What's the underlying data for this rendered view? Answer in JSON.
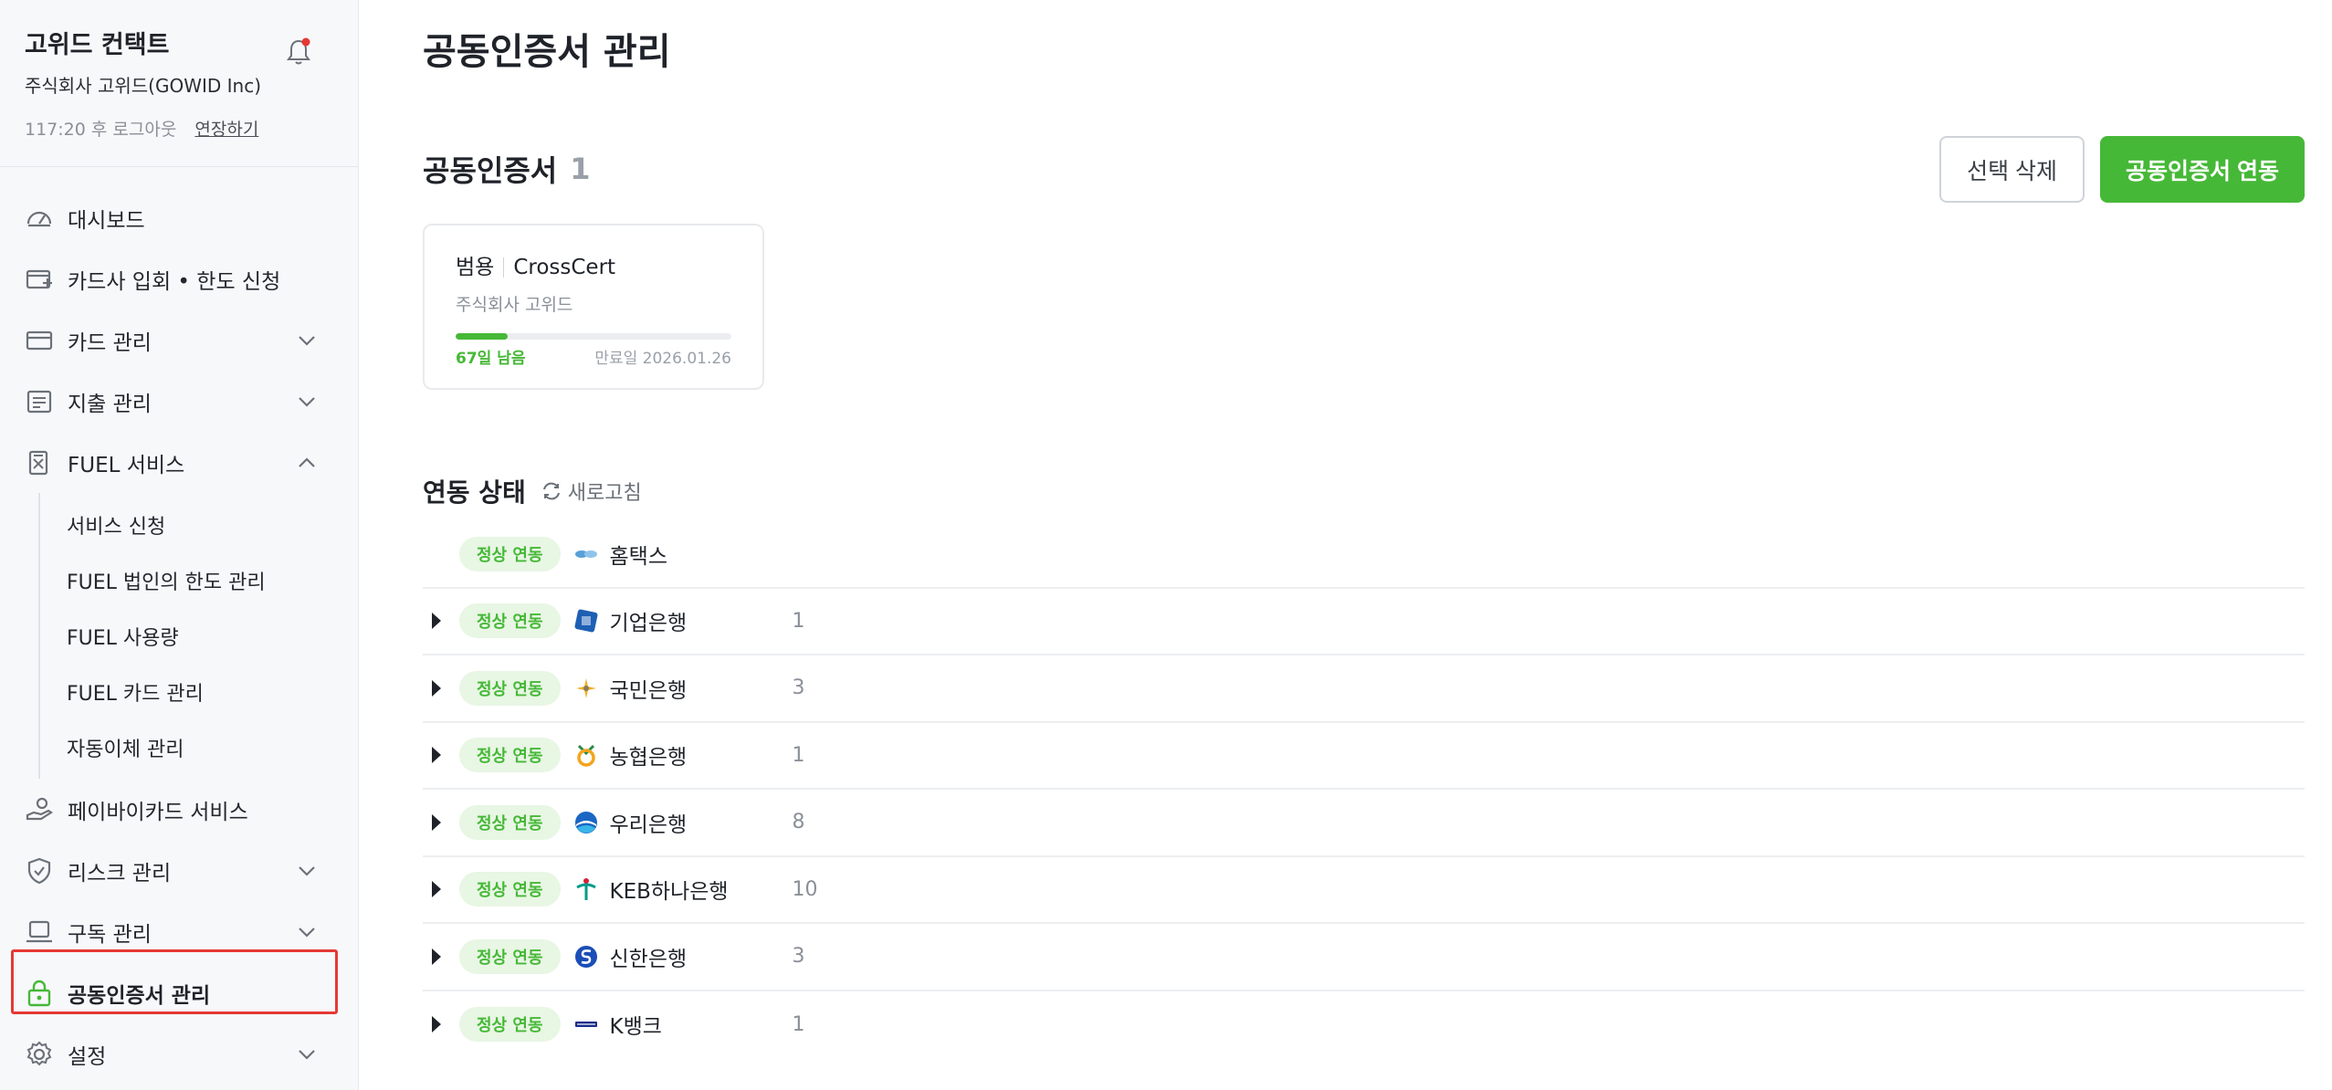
{
  "sidebar": {
    "title": "고위드 컨택트",
    "company": "주식회사 고위드(GOWID Inc)",
    "session_text": "117:20 후 로그아웃",
    "extend_label": "연장하기",
    "items": [
      {
        "label": "대시보드"
      },
      {
        "label": "카드사 입회 • 한도 신청"
      },
      {
        "label": "카드 관리"
      },
      {
        "label": "지출 관리"
      },
      {
        "label": "FUEL 서비스"
      },
      {
        "label": "페이바이카드 서비스"
      },
      {
        "label": "리스크 관리"
      },
      {
        "label": "구독 관리"
      },
      {
        "label": "공동인증서 관리"
      },
      {
        "label": "설정"
      }
    ],
    "fuel_sub": [
      {
        "label": "서비스 신청"
      },
      {
        "label": "FUEL 법인의 한도 관리"
      },
      {
        "label": "FUEL 사용량"
      },
      {
        "label": "FUEL 카드 관리"
      },
      {
        "label": "자동이체 관리"
      }
    ]
  },
  "main": {
    "page_title": "공동인증서 관리",
    "section_title": "공동인증서",
    "section_count": "1",
    "delete_button": "선택 삭제",
    "connect_button": "공동인증서 연동",
    "cert": {
      "type": "범용",
      "issuer": "CrossCert",
      "owner": "주식회사 고위드",
      "progress": 0.19,
      "days_left": "67일 남음",
      "expiry": "만료일 2026.01.26"
    },
    "status_title": "연동 상태",
    "refresh_label": "새로고침",
    "rows": [
      {
        "status": "정상 연동",
        "name": "홈택스",
        "count": ""
      },
      {
        "status": "정상 연동",
        "name": "기업은행",
        "count": "1"
      },
      {
        "status": "정상 연동",
        "name": "국민은행",
        "count": "3"
      },
      {
        "status": "정상 연동",
        "name": "농협은행",
        "count": "1"
      },
      {
        "status": "정상 연동",
        "name": "우리은행",
        "count": "8"
      },
      {
        "status": "정상 연동",
        "name": "KEB하나은행",
        "count": "10"
      },
      {
        "status": "정상 연동",
        "name": "신한은행",
        "count": "3"
      },
      {
        "status": "정상 연동",
        "name": "K뱅크",
        "count": "1"
      }
    ]
  },
  "colors": {
    "accent": "#46b837",
    "badge_bg": "#e8f6e4",
    "highlight_border": "#e53935"
  }
}
